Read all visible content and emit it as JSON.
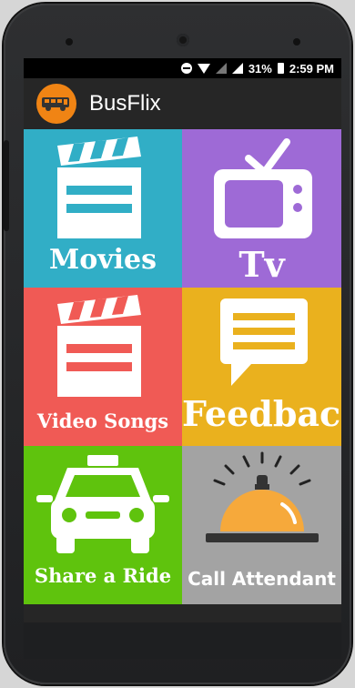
{
  "status_bar": {
    "battery": "31%",
    "time": "2:59 PM"
  },
  "app_bar": {
    "title": "BusFlix"
  },
  "tiles": [
    {
      "label": "Movies",
      "color": "#31aec6",
      "icon": "clapperboard-icon"
    },
    {
      "label": "Tv",
      "color": "#9e6ad6",
      "icon": "tv-icon"
    },
    {
      "label": "Video Songs",
      "color": "#f05a55",
      "icon": "clapperboard-icon"
    },
    {
      "label": "Feedback",
      "color": "#eab11e",
      "icon": "speech-bubble-icon"
    },
    {
      "label": "Share a Ride",
      "color": "#5fc30d",
      "icon": "taxi-icon"
    },
    {
      "label": "Call Attendant",
      "color": "#a3a3a3",
      "icon": "service-bell-icon"
    }
  ]
}
